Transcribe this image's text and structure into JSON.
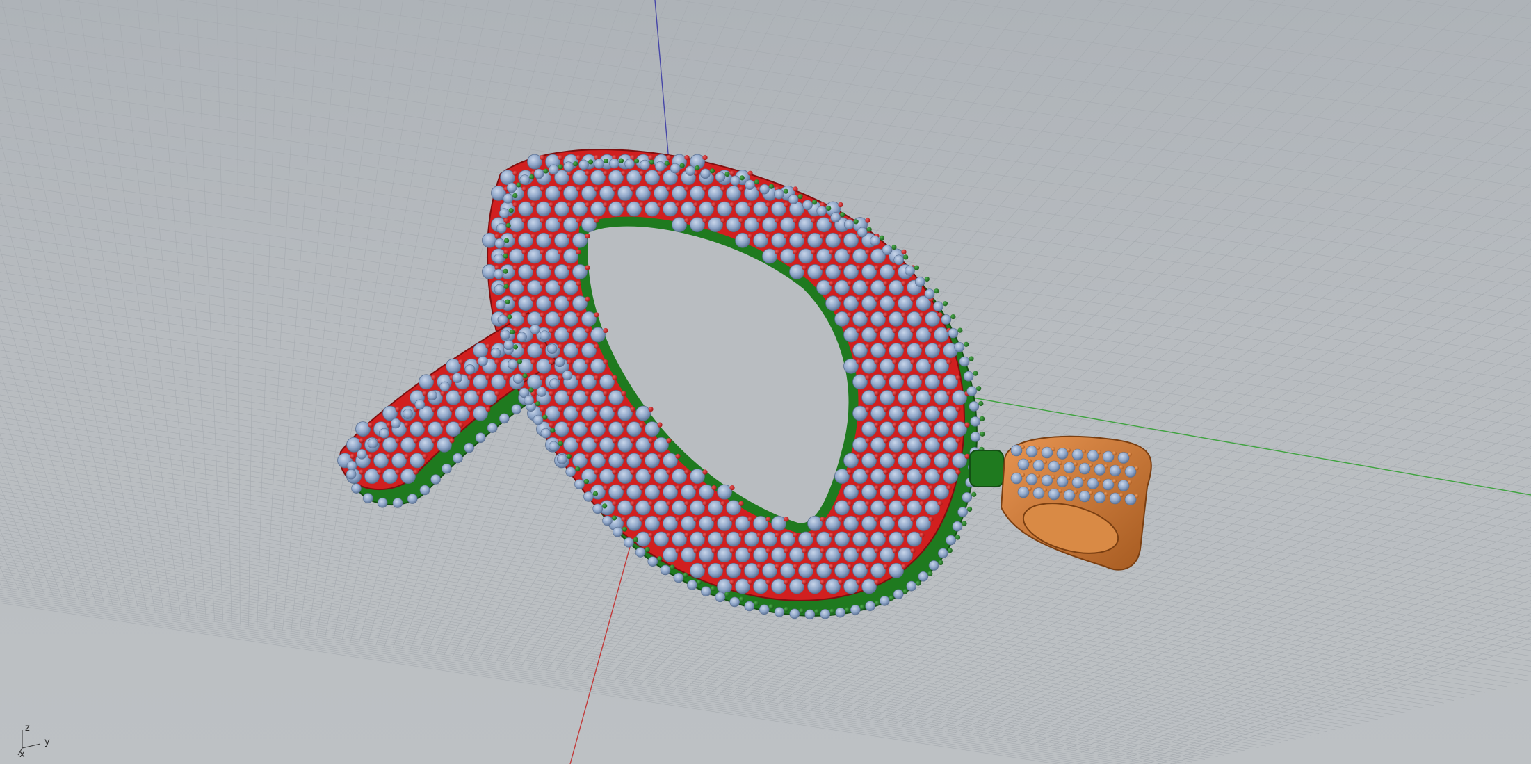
{
  "viewport": {
    "background_color": "#b9bdc1",
    "grid_minor_color": "#a6abb0",
    "grid_major_color": "#8f959b",
    "x_axis_color": "#c23a3a",
    "y_axis_color": "#3fa33f",
    "z_axis_color": "#4646a8"
  },
  "axis_widget": {
    "z_label": "z",
    "y_label": "y",
    "x_label": "x"
  },
  "model": {
    "letter_color": "#d11f1f",
    "base_color": "#1f7a1f",
    "gem_color": "#8fa6c8",
    "bail_color": "#c8782f"
  }
}
